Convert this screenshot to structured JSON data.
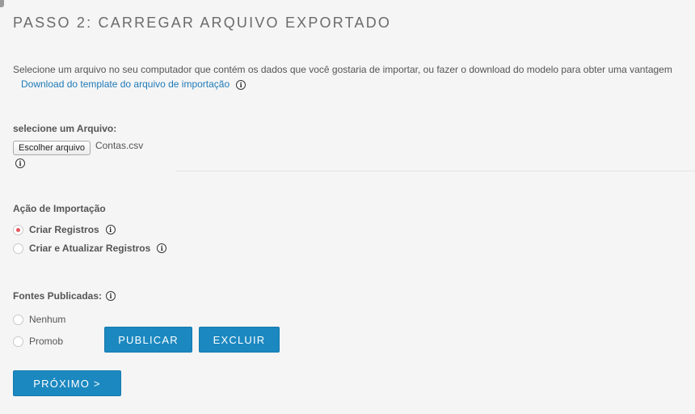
{
  "title": "PASSO 2: CARREGAR ARQUIVO EXPORTADO",
  "intro_text": "Selecione um arquivo no seu computador que contém os dados que você gostaria de importar, ou fazer o download do modelo para obter uma vantagem",
  "download_link": "Download do template do arquivo de importação",
  "info_glyph": "i",
  "file_section": {
    "label": "selecione um Arquivo:",
    "button_label": "Escolher arquivo",
    "file_name": "Contas.csv"
  },
  "import_action": {
    "label": "Ação de Importação",
    "options": [
      {
        "label": "Criar Registros",
        "selected": true
      },
      {
        "label": "Criar e Atualizar Registros",
        "selected": false
      }
    ]
  },
  "published_sources": {
    "label": "Fontes Publicadas:",
    "options": [
      {
        "label": "Nenhum",
        "selected": false
      },
      {
        "label": "Promob",
        "selected": false
      }
    ]
  },
  "buttons": {
    "publish": "PUBLICAR",
    "delete": "EXCLUIR",
    "next": "PRÓXIMO >"
  },
  "colors": {
    "primary_button": "#1b88c0",
    "link": "#1f7ab8",
    "radio_selected": "#e2575f",
    "background": "#f5f5f5"
  },
  "icons": [
    "info-icon"
  ]
}
